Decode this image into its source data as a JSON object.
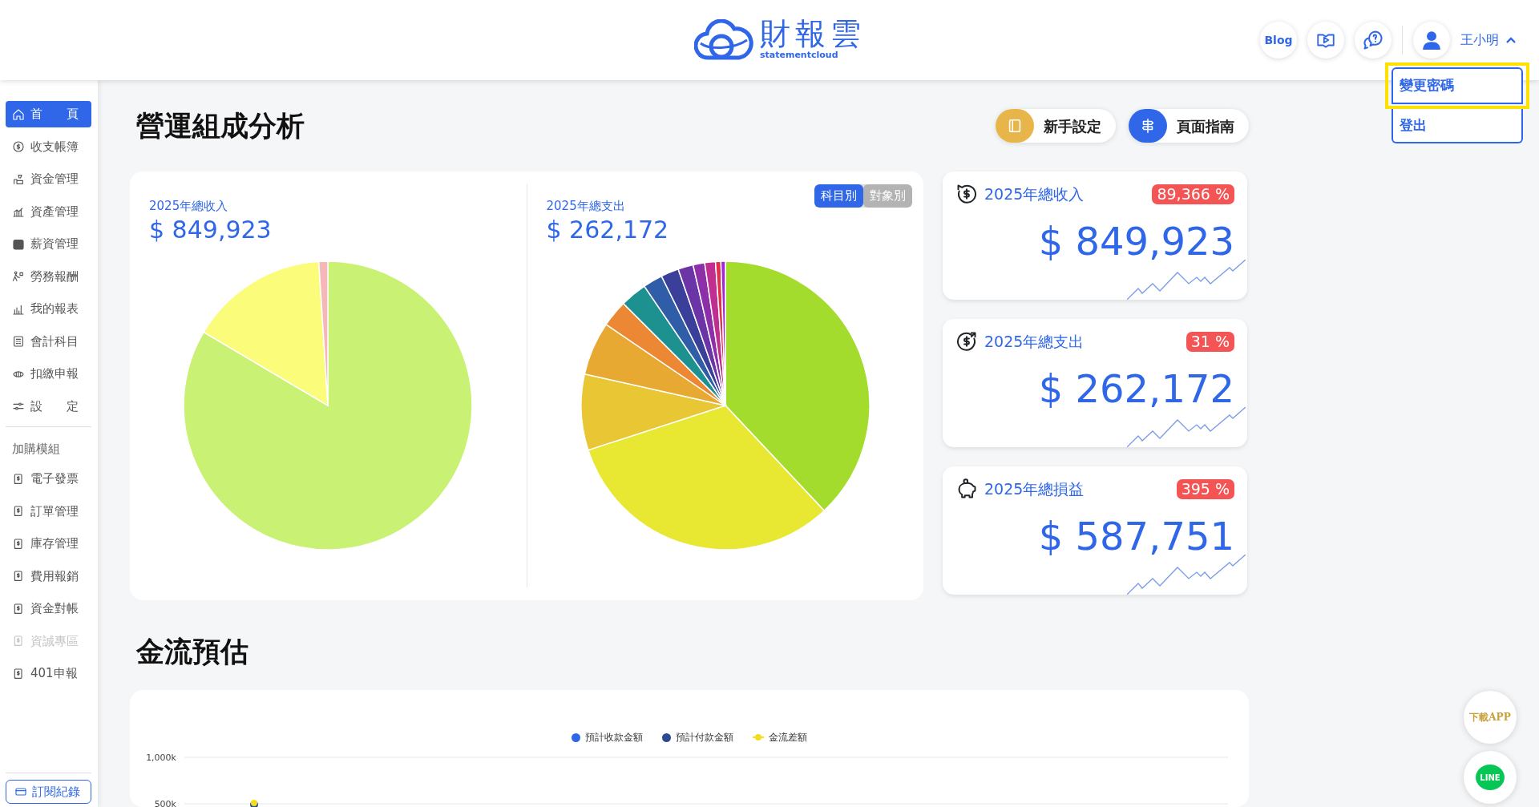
{
  "header": {
    "logo_text": "財報雲",
    "logo_subtext": "statementcloud",
    "blog_label": "Blog",
    "user_name": "王小明",
    "user_menu_expanded": true,
    "user_menu": [
      {
        "label": "變更密碼",
        "highlighted": true
      },
      {
        "label": "登出",
        "highlighted": false
      }
    ]
  },
  "sidebar": {
    "items": [
      {
        "label": "首　　頁",
        "selected": true,
        "disabled": false
      },
      {
        "label": "收支帳簿",
        "selected": false,
        "disabled": false
      },
      {
        "label": "資金管理",
        "selected": false,
        "disabled": false
      },
      {
        "label": "資產管理",
        "selected": false,
        "disabled": false
      },
      {
        "label": "薪資管理",
        "selected": false,
        "disabled": false
      },
      {
        "label": "勞務報酬",
        "selected": false,
        "disabled": false
      },
      {
        "label": "我的報表",
        "selected": false,
        "disabled": false
      },
      {
        "label": "會計科目",
        "selected": false,
        "disabled": false
      },
      {
        "label": "扣繳申報",
        "selected": false,
        "disabled": false
      },
      {
        "label": "設　　定",
        "selected": false,
        "disabled": false
      }
    ],
    "addon_heading": "加購模組",
    "addons": [
      {
        "label": "電子發票",
        "disabled": false
      },
      {
        "label": "訂單管理",
        "disabled": false
      },
      {
        "label": "庫存管理",
        "disabled": false
      },
      {
        "label": "費用報銷",
        "disabled": false
      },
      {
        "label": "資金對帳",
        "disabled": false
      },
      {
        "label": "資誠專區",
        "disabled": true
      },
      {
        "label": "401申報",
        "disabled": false
      }
    ],
    "subscription_button": "訂閱紀錄"
  },
  "analysis": {
    "title": "營運組成分析",
    "buttons": [
      {
        "label": "新手設定",
        "kind": "setup"
      },
      {
        "label": "頁面指南",
        "kind": "guide"
      }
    ],
    "income": {
      "label": "2025年總收入",
      "amount": "$ 849,923"
    },
    "expense": {
      "label": "2025年總支出",
      "amount": "$ 262,172",
      "toggle": [
        {
          "label": "科目別",
          "selected": true
        },
        {
          "label": "對象別",
          "selected": false
        }
      ]
    }
  },
  "summary_cards": [
    {
      "kind": "income",
      "label": "2025年總收入",
      "change": "89,366 %",
      "amount": "$ 849,923"
    },
    {
      "kind": "expense",
      "label": "2025年總支出",
      "change": "31 %",
      "amount": "$ 262,172"
    },
    {
      "kind": "profit",
      "label": "2025年總損益",
      "change": "395 %",
      "amount": "$ 587,751"
    }
  ],
  "cashflow": {
    "title": "金流預估",
    "legend": [
      {
        "name": "預計收款金額",
        "color": "#2f67e8",
        "kind": "dot"
      },
      {
        "name": "預計付款金額",
        "color": "#2b4a8f",
        "kind": "dot"
      },
      {
        "name": "金流差額",
        "color": "#f5dd1a",
        "kind": "line"
      }
    ],
    "y_axis_labels": [
      "1,000k",
      "500k"
    ]
  },
  "floating": {
    "download_label": "下載APP",
    "line_label": "LINE"
  }
}
